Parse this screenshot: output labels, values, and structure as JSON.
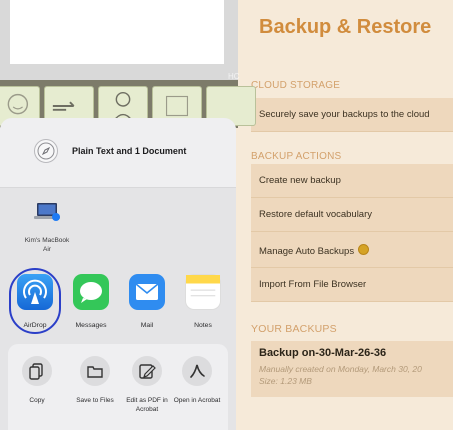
{
  "app": {
    "title": "Backup & Restore",
    "cloud_section": "CLOUD STORAGE",
    "cloud_item": "Securely save your backups to the cloud",
    "actions_section": "BACKUP ACTIONS",
    "actions": [
      "Create new backup",
      "Restore default vocabulary",
      "Manage Auto Backups",
      "Import From File Browser"
    ],
    "backups_section": "YOUR BACKUPS",
    "backup": {
      "title": "Backup on-30-Mar-26-36",
      "created": "Manually created on Monday, March 30, 20",
      "size": "Size: 1.23 MB"
    }
  },
  "board": {
    "hint": "HC"
  },
  "share_sheet": {
    "title": "Plain Text and 1 Document",
    "device": {
      "name": "Kim's MacBook Air"
    },
    "apps": [
      "AirDrop",
      "Messages",
      "Mail",
      "Notes"
    ],
    "actions": [
      "Copy",
      "Save to Files",
      "Edit as PDF in Acrobat",
      "Open in Acrobat"
    ]
  },
  "colors": {
    "accent": "#d18c3d",
    "airdrop_highlight": "#2b3fc8",
    "messages": "#34c759",
    "mail": "#2f8cf0"
  }
}
